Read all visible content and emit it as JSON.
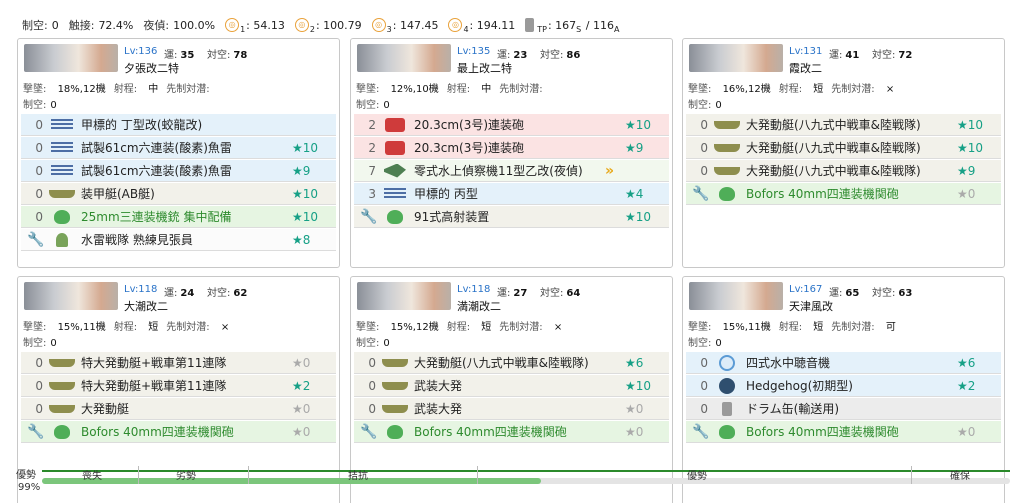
{
  "summary": {
    "air_label": "制空:",
    "air_value": "0",
    "contact_label": "触接:",
    "contact_value": "72.4%",
    "night_label": "夜偵:",
    "night_value": "100.0%",
    "los": [
      {
        "sub": "1",
        "value": ": 54.13"
      },
      {
        "sub": "2",
        "value": ": 100.79"
      },
      {
        "sub": "3",
        "value": ": 147.45"
      },
      {
        "sub": "4",
        "value": ": 194.11"
      }
    ],
    "tp_label": "TP",
    "tp_value": ": 167",
    "tp_sub1": "S",
    "tp_sep": "/ 116",
    "tp_sub2": "A"
  },
  "labels": {
    "unk": "運:",
    "asw": "対空:",
    "shell": "撃墜:",
    "range": "射程:",
    "opening": "先制対潜:",
    "airpow": "制空:"
  },
  "ships": [
    {
      "lv": "Lv:136",
      "unk": "35",
      "asw": "78",
      "name": "夕張改二特",
      "shell": "18%,12機",
      "range": "中",
      "opening": "",
      "air": "0",
      "equips": [
        {
          "count": "0",
          "icon": "bars",
          "name": "甲標的 丁型改(蛟龍改)",
          "star": "",
          "color": "blue"
        },
        {
          "count": "0",
          "icon": "bars",
          "name": "試製61cm六連装(酸素)魚雷",
          "star": "★10",
          "color": "blue"
        },
        {
          "count": "0",
          "icon": "bars",
          "name": "試製61cm六連装(酸素)魚雷",
          "star": "★9",
          "color": "blue"
        },
        {
          "count": "0",
          "icon": "boat",
          "name": "装甲艇(AB艇)",
          "star": "★10",
          "color": "beige"
        },
        {
          "count": "0",
          "icon": "blob",
          "name": "25mm三連装機銃 集中配備",
          "star": "★10",
          "color": "green"
        },
        {
          "count": "",
          "icon": "person",
          "name": "水雷戦隊 熟練見張員",
          "star": "★8",
          "color": "white",
          "wrench": true
        }
      ]
    },
    {
      "lv": "Lv:135",
      "unk": "23",
      "asw": "86",
      "name": "最上改二特",
      "shell": "12%,10機",
      "range": "中",
      "opening": "",
      "air": "0",
      "equips": [
        {
          "count": "2",
          "icon": "gun",
          "name": "20.3cm(3号)連装砲",
          "star": "★10",
          "color": "red"
        },
        {
          "count": "2",
          "icon": "gun",
          "name": "20.3cm(3号)連装砲",
          "star": "★9",
          "color": "red"
        },
        {
          "count": "7",
          "icon": "plane",
          "name": "零式水上偵察機11型乙改(夜偵)",
          "star": "",
          "color": "lgreen",
          "chev": "»"
        },
        {
          "count": "3",
          "icon": "bars",
          "name": "甲標的 丙型",
          "star": "★4",
          "color": "blue"
        },
        {
          "count": "",
          "icon": "blob",
          "name": "91式高射装置",
          "star": "★10",
          "color": "beige",
          "wrench": true
        }
      ]
    },
    {
      "lv": "Lv:131",
      "unk": "41",
      "asw": "72",
      "name": "霞改二",
      "shell": "16%,12機",
      "range": "短",
      "opening": "×",
      "air": "0",
      "equips": [
        {
          "count": "0",
          "icon": "boat",
          "name": "大発動艇(八九式中戦車&陸戦隊)",
          "star": "★10",
          "color": "beige"
        },
        {
          "count": "0",
          "icon": "boat",
          "name": "大発動艇(八九式中戦車&陸戦隊)",
          "star": "★10",
          "color": "beige"
        },
        {
          "count": "0",
          "icon": "boat",
          "name": "大発動艇(八九式中戦車&陸戦隊)",
          "star": "★9",
          "color": "beige"
        },
        {
          "count": "",
          "icon": "blob",
          "name": "Bofors 40mm四連装機関砲",
          "star": "★0",
          "color": "green",
          "wrench": true,
          "gray": true
        }
      ]
    },
    {
      "lv": "Lv:118",
      "unk": "24",
      "asw": "62",
      "name": "大潮改二",
      "shell": "15%,11機",
      "range": "短",
      "opening": "×",
      "air": "0",
      "equips": [
        {
          "count": "0",
          "icon": "boat",
          "name": "特大発動艇+戦車第11連隊",
          "star": "★0",
          "color": "beige",
          "gray": true
        },
        {
          "count": "0",
          "icon": "boat",
          "name": "特大発動艇+戦車第11連隊",
          "star": "★2",
          "color": "beige"
        },
        {
          "count": "0",
          "icon": "boat",
          "name": "大発動艇",
          "star": "★0",
          "color": "beige",
          "gray": true
        },
        {
          "count": "",
          "icon": "blob",
          "name": "Bofors 40mm四連装機関砲",
          "star": "★0",
          "color": "green",
          "wrench": true,
          "gray": true
        }
      ]
    },
    {
      "lv": "Lv:118",
      "unk": "27",
      "asw": "64",
      "name": "満潮改二",
      "shell": "15%,12機",
      "range": "短",
      "opening": "×",
      "air": "0",
      "equips": [
        {
          "count": "0",
          "icon": "boat",
          "name": "大発動艇(八九式中戦車&陸戦隊)",
          "star": "★6",
          "color": "beige"
        },
        {
          "count": "0",
          "icon": "boat",
          "name": "武装大発",
          "star": "★10",
          "color": "beige"
        },
        {
          "count": "0",
          "icon": "boat",
          "name": "武装大発",
          "star": "★0",
          "color": "beige",
          "gray": true
        },
        {
          "count": "",
          "icon": "blob",
          "name": "Bofors 40mm四連装機関砲",
          "star": "★0",
          "color": "green",
          "wrench": true,
          "gray": true
        }
      ]
    },
    {
      "lv": "Lv:167",
      "unk": "65",
      "asw": "63",
      "name": "天津風改",
      "shell": "15%,11機",
      "range": "短",
      "opening": "可",
      "air": "0",
      "equips": [
        {
          "count": "0",
          "icon": "sonar",
          "name": "四式水中聴音機",
          "star": "★6",
          "color": "blue"
        },
        {
          "count": "0",
          "icon": "hedge",
          "name": "Hedgehog(初期型)",
          "star": "★2",
          "color": "blue"
        },
        {
          "count": "0",
          "icon": "drum",
          "name": "ドラム缶(輸送用)",
          "star": "",
          "color": "gray"
        },
        {
          "count": "",
          "icon": "blob",
          "name": "Bofors 40mm四連装機関砲",
          "star": "★0",
          "color": "green",
          "wrench": true,
          "gray": true
        }
      ]
    }
  ],
  "gauge": {
    "label": "優勢",
    "percent": "99%",
    "level": 0.515,
    "segments": [
      "喪失",
      "劣勢",
      "拮抗",
      "優勢",
      "確保"
    ]
  }
}
